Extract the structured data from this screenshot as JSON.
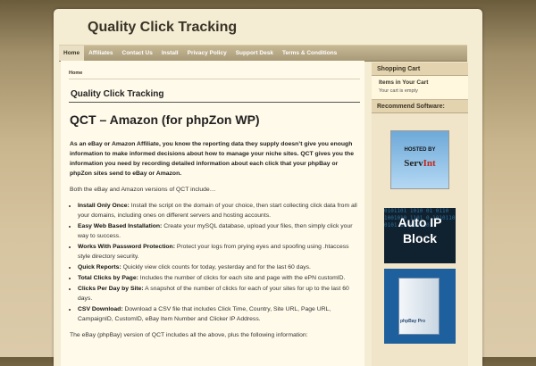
{
  "site": {
    "title": "Quality Click Tracking"
  },
  "nav": {
    "items": [
      "Home",
      "Affiliates",
      "Contact Us",
      "Install",
      "Privacy Policy",
      "Support Desk",
      "Terms & Conditions"
    ]
  },
  "breadcrumb": "Home",
  "page_title": "Quality Click Tracking",
  "post_title": "QCT – Amazon (for phpZon WP)",
  "intro": "As an eBay or Amazon Affiliate, you know the reporting data they supply doesn’t give you enough information to make informed decisions about how to manage your niche sites. QCT gives you the information you need by recording detailed information about each click that your phpBay or phpZon sites send to eBay or Amazon.",
  "both_text": "Both the eBay and Amazon versions of QCT include…",
  "features": [
    {
      "name": "Install Only Once:",
      "desc": " Install the script on the domain of your choice, then start collecting click data from all your domains, including ones on different servers and hosting accounts."
    },
    {
      "name": "Easy Web Based Installation:",
      "desc": " Create your mySQL database, upload your files, then simply click your way to success."
    },
    {
      "name": "Works With Password Protection:",
      "desc": " Protect your logs from prying eyes and spoofing using .htaccess style directory security."
    },
    {
      "name": "Quick Reports:",
      "desc": " Quickly view click counts for today, yesterday and for the last 60 days."
    },
    {
      "name": "Total Clicks by Page:",
      "desc": " Includes the number of clicks for each site and page with the ePN customID."
    },
    {
      "name": "Clicks Per Day by Site:",
      "desc": " A snapshot of the number of clicks for each of your sites for up to the last 60 days."
    },
    {
      "name": "CSV Download:",
      "desc": " Download a CSV file that includes Click Time, Country, Site URL, Page URL, CampaignID, CustomID, eBay Item Number and Clicker IP Address."
    }
  ],
  "ebay_text": "The eBay (phpBay) version of QCT includes all the above, plus the following information:",
  "sidebar": {
    "cart_heading": "Shopping Cart",
    "cart_subheading": "Items in Your Cart",
    "cart_empty": "Your cart is empty",
    "recommend_heading": "Recommend Software:",
    "ad1": {
      "line1": "HOSTED BY",
      "brand_main": "Serv",
      "brand_accent": "Int"
    },
    "ad2": {
      "line1": "Auto IP",
      "line2": "Block",
      "bits": "0101101 1010 01 0110 1001010 1101 0 1010110 0101 10 0110101"
    },
    "ad3": {
      "label": "phpBay Pro"
    }
  }
}
